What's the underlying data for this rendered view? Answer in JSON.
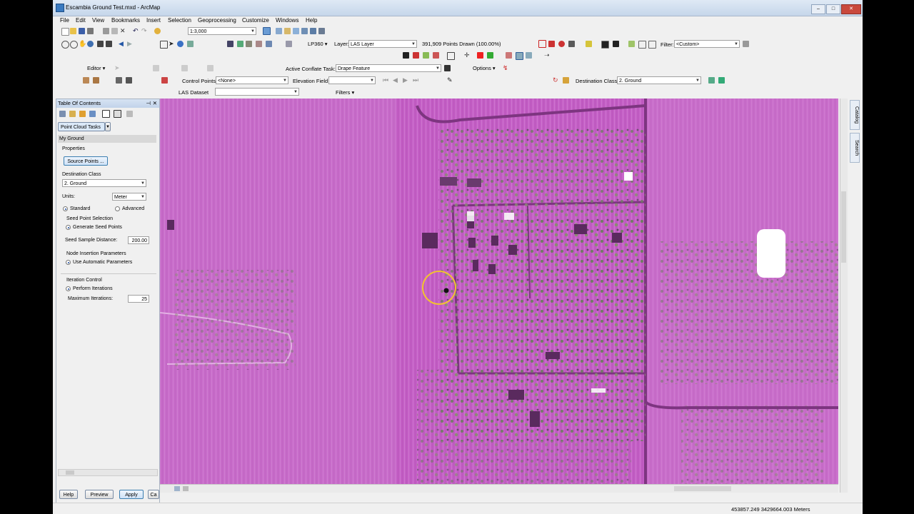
{
  "window": {
    "title": "Escambia Ground Test.mxd - ArcMap"
  },
  "menu": [
    "File",
    "Edit",
    "View",
    "Bookmarks",
    "Insert",
    "Selection",
    "Geoprocessing",
    "Customize",
    "Windows",
    "Help"
  ],
  "toolbar": {
    "scale": "1:3,000",
    "lp360": "LP360 ▾",
    "layer_label": "Layer:",
    "layer_value": "LAS Layer",
    "points_drawn": "391,909 Points Drawn (100.00%)",
    "filter_label": "Filter:",
    "filter_value": "<Custom>",
    "editor": "Editor ▾",
    "conflate_label": "Active Conflate Task:",
    "conflate_value": "Drape Feature",
    "options": "Options ▾",
    "control_points_label": "Control Points:",
    "control_points_value": "<None>",
    "elevation_field_label": "Elevation Field:",
    "destination_class_label": "Destination Class:",
    "destination_class_value": "2. Ground",
    "las_dataset_label": "LAS Dataset",
    "filters": "Filters ▾"
  },
  "toc": {
    "title": "Table Of Contents",
    "tasks_button": "Point Cloud Tasks",
    "task_name": "My Ground",
    "properties": "Properties",
    "source_points": "Source Points ...",
    "destination_class_label": "Destination Class",
    "destination_class_value": "2. Ground",
    "units_label": "Units:",
    "units_value": "Meter",
    "mode_standard": "Standard",
    "mode_advanced": "Advanced",
    "seed_selection_label": "Seed Point Selection",
    "generate_seed": "Generate Seed Points",
    "seed_distance_label": "Seed Sample Distance:",
    "seed_distance_value": "200.00",
    "node_params_label": "Node Insertion Parameters",
    "use_auto": "Use Automatic Parameters",
    "iteration_label": "Iteration Control",
    "perform_iterations": "Perform Iterations",
    "max_iterations_label": "Maximum Iterations:",
    "max_iterations_value": "25",
    "help": "Help",
    "preview": "Preview",
    "apply": "Apply",
    "cancel": "Ca"
  },
  "side_tabs": [
    "Catalog",
    "Search"
  ],
  "status": {
    "coords": "453857.249  3429664.003 Meters"
  },
  "colors": {
    "map_bg": "#c35ec5",
    "cursor_ring": "#f2c230"
  }
}
